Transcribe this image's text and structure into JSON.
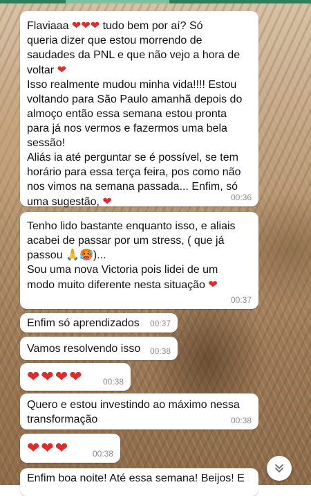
{
  "messages": [
    {
      "id": "m1",
      "lines": [
        "Flaviaaa ❤❤❤ tudo bem por aí? Só",
        "queria dizer que estou morrendo de",
        "saudades da PNL e que não vejo a hora de",
        "voltar ❤",
        "Isso realmente mudou minha vida!!!! Estou",
        "voltando para São Paulo amanhã depois do",
        "almoço então essa semana estou pronta",
        "para já nos vermos e fazermos uma bela",
        "sessão!",
        "Aliás ia até perguntar se é possível, se tem",
        "horário para essa terça feira, pos como não",
        "nos vimos na semana passada... Enfim, só",
        "uma sugestão, ❤"
      ],
      "time": "00:36"
    },
    {
      "id": "m2",
      "lines": [
        "Tenho lido bastante enquanto isso, e aliais",
        "acabei de passar por um stress, ( que já",
        "passou 🙏🥵)...",
        "Sou uma nova Victoria pois lidei de um",
        "modo muito diferente nesta situação ❤"
      ],
      "time": "00:37"
    },
    {
      "id": "m3",
      "text": "Enfim só aprendizados",
      "time": "00:37"
    },
    {
      "id": "m4",
      "text": "Vamos resolvendo isso",
      "time": "00:38"
    },
    {
      "id": "m5",
      "text": "❤❤❤❤",
      "time": "00:38"
    },
    {
      "id": "m6",
      "lines": [
        "Quero e estou investindo ao máximo nessa",
        "transformação"
      ],
      "time": "00:38"
    },
    {
      "id": "m7",
      "text": "❤❤❤",
      "time": "00:38"
    },
    {
      "id": "m8",
      "text": "Enfim boa noite! Até essa semana! Beijos! E"
    }
  ],
  "colors": {
    "bubble": "#ffffff",
    "heart": "#e02b2b",
    "timestamp": "#8c8c8c",
    "header": "#2e7d5b"
  },
  "icons": {
    "scroll_down": "double-chevron-down-icon"
  }
}
